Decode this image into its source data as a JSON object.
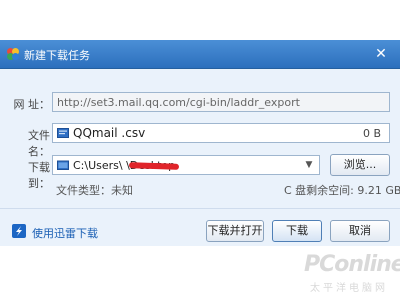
{
  "dialog": {
    "title": "新建下载任务",
    "close_glyph": "✕"
  },
  "url_row": {
    "label": "网  址：",
    "value": "http://set3.mail.qq.com/cgi-bin/laddr_export"
  },
  "filename_row": {
    "label": "文件名：",
    "value": "QQmail .csv",
    "size": "0 B",
    "icon": "csv-file-icon"
  },
  "saveto_row": {
    "label": "下载到：",
    "value": "C:\\Users\\            \\Desktop",
    "icon": "folder-icon",
    "browse_label": "浏览..."
  },
  "file_info": {
    "type_label": "文件类型：未知",
    "free_space": "C 盘剩余空间: 9.21 GB"
  },
  "footer": {
    "thunder_link": "使用迅雷下载",
    "download_open_label": "下载并打开",
    "download_label": "下载",
    "cancel_label": "取消"
  },
  "watermark": {
    "main": "PConline",
    "sub": "太平洋电脑网"
  },
  "colors": {
    "titlebar": "#2c6fbd",
    "dialog_bg": "#eaf2fb",
    "link": "#1a5fb4",
    "redaction": "#e0242a"
  }
}
